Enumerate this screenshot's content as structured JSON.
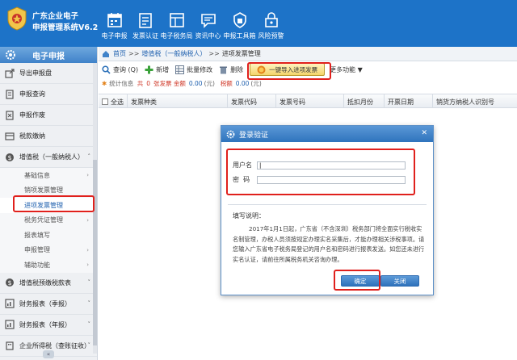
{
  "app": {
    "title_line1": "广东企业电子",
    "title_line2": "申报管理系统V6.2"
  },
  "topnav": [
    {
      "label": "电子申报",
      "icon": "calendar-icon"
    },
    {
      "label": "发票认证",
      "icon": "invoice-icon"
    },
    {
      "label": "电子税务局",
      "icon": "tax-bureau-icon"
    },
    {
      "label": "资讯中心",
      "icon": "message-icon"
    },
    {
      "label": "申报工具箱",
      "icon": "toolbox-icon"
    },
    {
      "label": "风险预警",
      "icon": "shield-icon"
    }
  ],
  "sidebar": {
    "header": "电子申报",
    "items": {
      "export": "导出申报盘",
      "query": "申报查询",
      "void": "申报作废",
      "payment": "税款缴纳",
      "vat": "增值税（一般纳税人）",
      "vat_prepay": "增值税预缴税款表",
      "fin_month": "财务报表（季报）",
      "fin_year": "财务报表（年报）",
      "corp_tax": "企业所得税（查账征收）"
    },
    "vat_sub": [
      {
        "label": "基础信息",
        "arrow": "›"
      },
      {
        "label": "销项发票管理",
        "arrow": ""
      },
      {
        "label": "进项发票管理",
        "arrow": ""
      },
      {
        "label": "税务凭证管理",
        "arrow": "›"
      },
      {
        "label": "报表填写",
        "arrow": ""
      },
      {
        "label": "申报管理",
        "arrow": "›"
      },
      {
        "label": "辅助功能",
        "arrow": "›"
      }
    ],
    "collapse": "«"
  },
  "breadcrumb": {
    "home": "首页",
    "sep": ">>",
    "level2": "增值税（一般纳税人）",
    "sep2": ">>",
    "current": "进项发票管理"
  },
  "toolbar": {
    "query": "查询",
    "query_key": "(Q)",
    "add": "新增",
    "batch_edit": "批量修改",
    "delete": "删除",
    "import": "一键导入进项发票",
    "more": "更多功能"
  },
  "stats": {
    "label": "统计信息",
    "prefix": "共",
    "count": "0",
    "unit": "张发票 金额",
    "amount": "0.00",
    "yuan1": "(元)",
    "tax_label": "税额",
    "tax": "0.00",
    "yuan2": "(元)"
  },
  "table": {
    "select_all": "全选",
    "columns": [
      "发票种类",
      "发票代码",
      "发票号码",
      "抵扣月份",
      "开票日期",
      "销货方纳税人识别号"
    ]
  },
  "modal": {
    "title": "登录验证",
    "close": "✕",
    "username_label": "用户名",
    "username_value": "|",
    "password_label": "密  码",
    "password_value": "",
    "notes_title": "填写说明：",
    "notes_body": "2017年1月1日起，广东省（不含深圳）税务部门将全面实行税收实名制管理，办税人员须按规定办理实名采集后，才能办理相关涉税事项。请您输入广东省电子税务局登记的用户名和密码进行报表发送。如您还未进行实名认证，请前往所属税务机关咨询办理。",
    "ok": "确定",
    "cancel": "关闭"
  },
  "colors": {
    "header": "#1d73c8",
    "annotation": "#e0201c",
    "link": "#1d5fae"
  }
}
